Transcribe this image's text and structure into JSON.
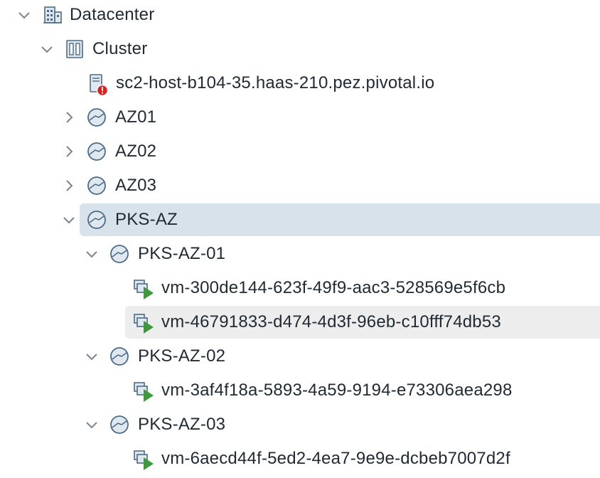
{
  "tree": {
    "datacenter": {
      "label": "Datacenter",
      "icon": "datacenter-icon",
      "expanded": true
    },
    "cluster": {
      "label": "Cluster",
      "icon": "cluster-icon",
      "expanded": true
    },
    "host": {
      "label": "sc2-host-b104-35.haas-210.pez.pivotal.io",
      "icon": "host-error-icon",
      "status": "error"
    },
    "pools": [
      {
        "label": "AZ01",
        "icon": "resource-pool-icon",
        "expanded": false
      },
      {
        "label": "AZ02",
        "icon": "resource-pool-icon",
        "expanded": false
      },
      {
        "label": "AZ03",
        "icon": "resource-pool-icon",
        "expanded": false
      },
      {
        "label": "PKS-AZ",
        "icon": "resource-pool-icon",
        "expanded": true,
        "selected": true
      }
    ],
    "sub_pools": [
      {
        "label": "PKS-AZ-01",
        "icon": "resource-pool-icon",
        "expanded": true,
        "vms": [
          {
            "label": "vm-300de144-623f-49f9-aac3-528569e5f6cb",
            "icon": "vm-powered-on-icon"
          },
          {
            "label": "vm-46791833-d474-4d3f-96eb-c10fff74db53",
            "icon": "vm-powered-on-icon",
            "hovered": true
          }
        ]
      },
      {
        "label": "PKS-AZ-02",
        "icon": "resource-pool-icon",
        "expanded": true,
        "vms": [
          {
            "label": "vm-3af4f18a-5893-4a59-9194-e73306aea298",
            "icon": "vm-powered-on-icon"
          }
        ]
      },
      {
        "label": "PKS-AZ-03",
        "icon": "resource-pool-icon",
        "expanded": true,
        "vms": [
          {
            "label": "vm-6aecd44f-5ed2-4ea7-9e9e-dcbeb7007d2f",
            "icon": "vm-powered-on-icon"
          }
        ]
      }
    ]
  },
  "colors": {
    "selected_bg": "#d7e2ea",
    "hover_bg": "#ededed",
    "chevron": "#7a8590",
    "icon_stroke": "#4e6b85",
    "icon_fill": "#dfe8ef",
    "vm_play": "#3c9a3c",
    "error": "#e02020"
  }
}
